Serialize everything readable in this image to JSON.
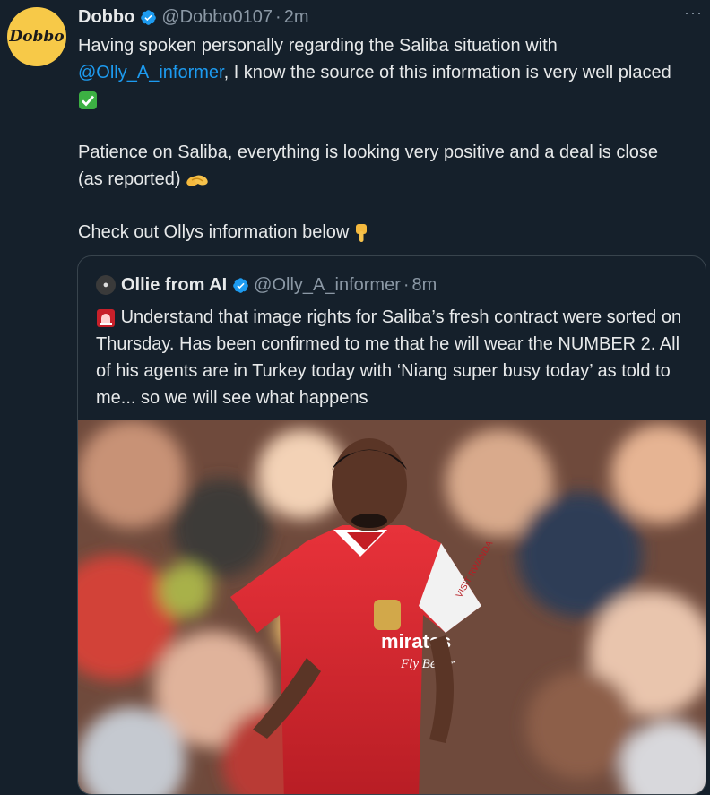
{
  "tweet": {
    "author_name": "Dobbo",
    "avatar_text": "Dobbo",
    "handle": "@Dobbo0107",
    "separator": "·",
    "time": "2m",
    "more": "···",
    "line1_pre": "Having spoken personally regarding the Saliba situation with ",
    "mention": "@Olly_A_informer",
    "line1_post": ", I know the source of this information is very well placed",
    "para2": "Patience on Saliba, everything is looking very positive and a deal is close (as reported)",
    "para3": "Check out Ollys information below"
  },
  "quoted": {
    "author_name": "Ollie from AI",
    "handle": "@Olly_A_informer",
    "separator": "·",
    "time": "8m",
    "text": "Understand that image rights for Saliba’s fresh contract were sorted on Thursday. Has been confirmed to me that he will wear the NUMBER 2. All of his agents are in Turkey today with ‘Niang super busy today’ as told to me... so we will see what happens"
  },
  "photo": {
    "sponsor_line1": "mirates",
    "sponsor_line2": "Fly Better",
    "sleeve_text": "VISIT RWANDA"
  },
  "colors": {
    "background": "#15202b",
    "text": "#e7e9ea",
    "muted": "#8b98a5",
    "link": "#1d9bf0",
    "border": "#38444d",
    "avatar_bg": "#f7c948",
    "shirt_red": "#e0262c"
  },
  "icons": [
    "verified-badge-icon",
    "check-mark-emoji-icon",
    "handshake-emoji-icon",
    "pointing-down-emoji-icon",
    "siren-emoji-icon",
    "more-options-icon"
  ]
}
